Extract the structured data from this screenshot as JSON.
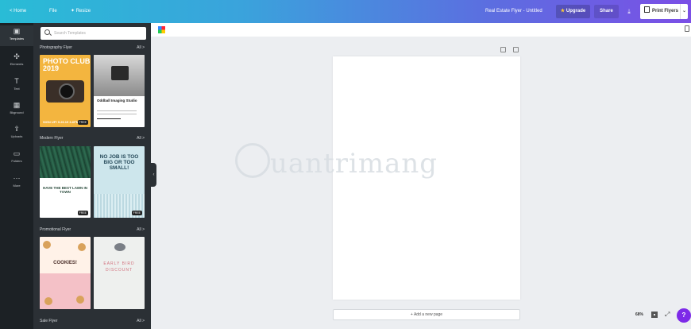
{
  "topbar": {
    "home": "< Home",
    "file": "File",
    "resize": "✦ Resize",
    "document_title": "Real Estate Flyer - Untitled",
    "upgrade": "Upgrade",
    "share": "Share",
    "download_icon": "download-icon",
    "print": "Print Flyers",
    "print_chevron": "⌄"
  },
  "rail": {
    "items": [
      {
        "label": "Templates",
        "icon": "▣"
      },
      {
        "label": "Elements",
        "icon": "✣"
      },
      {
        "label": "Text",
        "icon": "T"
      },
      {
        "label": "Bkground",
        "icon": "▦"
      },
      {
        "label": "Uploads",
        "icon": "⇪"
      },
      {
        "label": "Folders",
        "icon": "▭"
      },
      {
        "label": "More",
        "icon": "···"
      }
    ]
  },
  "panel": {
    "search_placeholder": "Search Templates",
    "sections": [
      {
        "title": "Photography Flyer",
        "all": "All  >"
      },
      {
        "title": "Modern Flyer",
        "all": "All  >"
      },
      {
        "title": "Promotional Flyer",
        "all": "All  >"
      },
      {
        "title": "Sale Flyer",
        "all": "All  >"
      }
    ],
    "free_badge": "FREE",
    "thumbs": {
      "photo_title": "PHOTO CLUB 2019",
      "photo_footer": "SIGN UP!  9.26.19  3-6PM",
      "odd_title": "Oddball Imaging Studio",
      "lawn_text": "HAVE THE BEST LAWN IN TOWN",
      "job_text": "NO JOB IS TOO BIG OR TOO SMALL!",
      "cookie_text": "COOKIES!",
      "bird_text": "EARLY BIRD DISCOUNT"
    }
  },
  "canvas": {
    "add_page": "+ Add a new page",
    "zoom": "68%",
    "help": "?"
  },
  "watermark": {
    "text": "uantrimang"
  }
}
